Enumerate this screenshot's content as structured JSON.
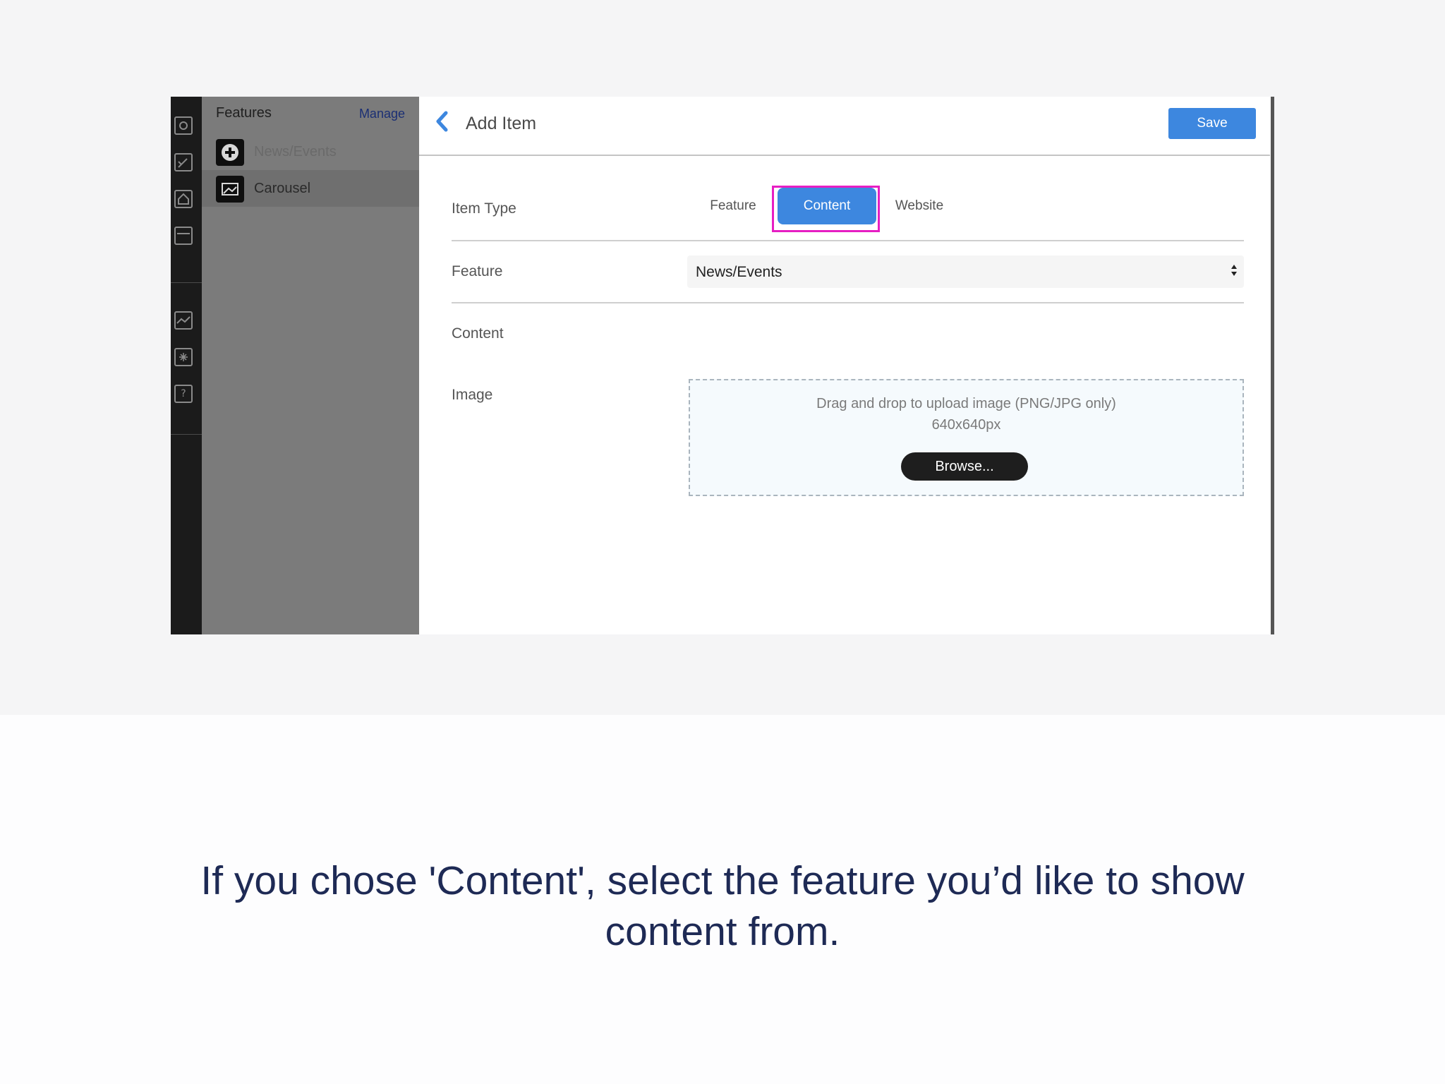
{
  "sidebar": {
    "title": "Features",
    "manage_label": "Manage",
    "items": [
      {
        "label": "News/Events",
        "icon": "plus-circle-icon",
        "selected": false
      },
      {
        "label": "Carousel",
        "icon": "image-icon",
        "selected": true
      }
    ]
  },
  "rail": {
    "icons": [
      "camera-icon",
      "edit-icon",
      "home-icon",
      "layout-icon",
      "chart-icon",
      "settings-icon",
      "help-icon"
    ],
    "help_glyph": "?"
  },
  "header": {
    "title": "Add Item",
    "save_label": "Save"
  },
  "form": {
    "item_type_label": "Item Type",
    "item_type_options": [
      "Feature",
      "Content",
      "Website"
    ],
    "item_type_selected": "Content",
    "feature_label": "Feature",
    "feature_value": "News/Events",
    "content_label": "Content",
    "image_label": "Image",
    "dropzone_text": "Drag and drop to upload image (PNG/JPG only)",
    "dropzone_size": "640x640px",
    "browse_label": "Browse..."
  },
  "caption": {
    "line1": "If you chose 'Content', select the feature you’d like to show",
    "line2": "content from."
  },
  "colors": {
    "accent": "#3d87df",
    "highlight": "#e61ec3",
    "caption": "#1e2a55"
  }
}
